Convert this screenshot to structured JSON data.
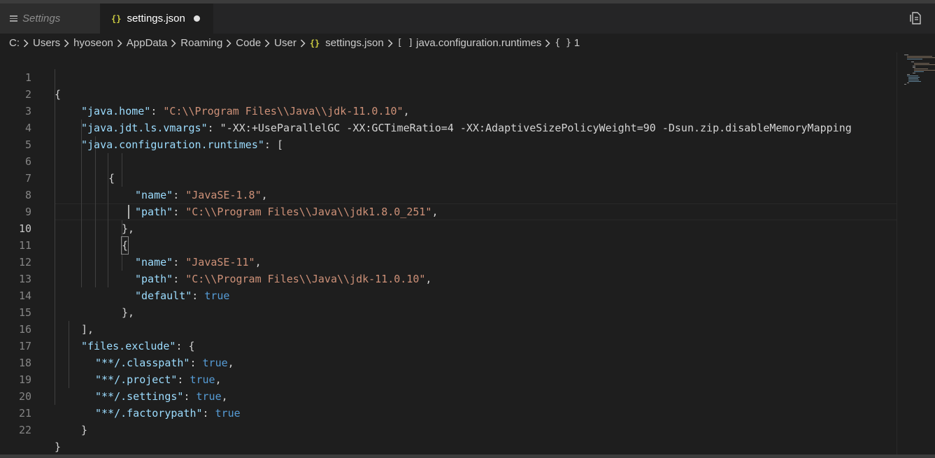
{
  "tabs": [
    {
      "label": "Settings",
      "icon": "lines-icon"
    },
    {
      "label": "settings.json",
      "icon": "json-braces-icon",
      "dirty": true
    }
  ],
  "braces_glyph": "{}",
  "breadcrumb": {
    "items": [
      "C:",
      "Users",
      "hyoseon",
      "AppData",
      "Roaming",
      "Code",
      "User",
      "settings.json",
      "java.configuration.runtimes",
      "1"
    ],
    "array_glyph": "[ ]",
    "object_glyph": "{ }"
  },
  "editor": {
    "active_line": 10,
    "line_numbers": [
      "1",
      "2",
      "3",
      "4",
      "5",
      "6",
      "7",
      "8",
      "9",
      "10",
      "11",
      "12",
      "13",
      "14",
      "15",
      "16",
      "17",
      "18",
      "19",
      "20",
      "21",
      "22"
    ],
    "lines": [
      "{",
      "\"java.home\": \"C:\\\\Program Files\\\\Java\\\\jdk-11.0.10\",",
      "\"java.jdt.ls.vmargs\": \"-XX:+UseParallelGC -XX:GCTimeRatio=4 -XX:AdaptiveSizePolicyWeight=90 -Dsun.zip.disableMemoryMapping",
      "\"java.configuration.runtimes\": [",
      "",
      "{",
      "\"name\": \"JavaSE-1.8\",",
      "\"path\": \"C:\\\\Program Files\\\\Java\\\\jdk1.8.0_251\",",
      "},",
      "{",
      "\"name\": \"JavaSE-11\",",
      "\"path\": \"C:\\\\Program Files\\\\Java\\\\jdk-11.0.10\",",
      "\"default\": true",
      "},",
      "],",
      "\"files.exclude\": {",
      "\"**/.classpath\": true,",
      "\"**/.project\": true,",
      "\"**/.settings\": true,",
      "\"**/.factorypath\": true",
      "}",
      "}"
    ]
  },
  "colors": {
    "background": "#1e1e1e",
    "key": "#9cdcfe",
    "string": "#ce9178",
    "boolean": "#569cd6",
    "punctuation": "#d4d4d4",
    "json_icon": "#cbcb41"
  },
  "icons": {
    "split_editor": "split-editor-icon",
    "chevron": "chevron-right-icon"
  }
}
